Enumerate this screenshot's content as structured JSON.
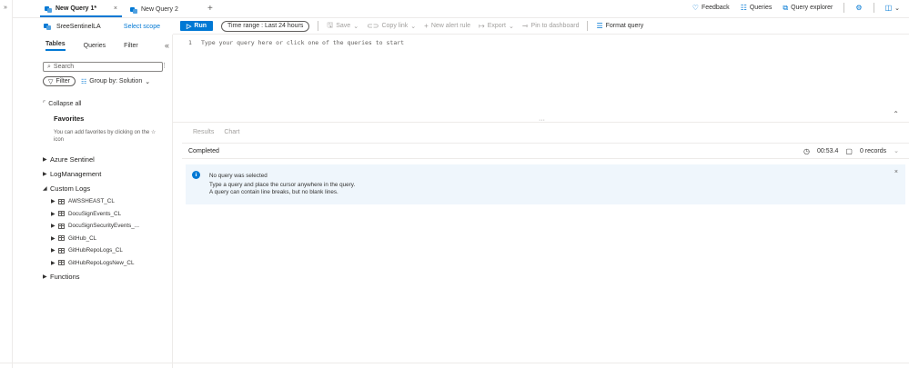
{
  "tabs": [
    {
      "label": "New Query 1*",
      "active": true,
      "close": "×"
    },
    {
      "label": "New Query 2",
      "active": false
    }
  ],
  "add_tab": "+",
  "rail_expand": "»",
  "top_links": {
    "feedback": "Feedback",
    "queries": "Queries",
    "query_explorer": "Query explorer"
  },
  "scope": {
    "workspace": "SreeSentinelLA",
    "select_scope": "Select scope"
  },
  "toolbar": {
    "run": "Run",
    "time_range": "Time range : Last 24 hours",
    "save": "Save",
    "copy_link": "Copy link",
    "new_alert_rule": "New alert rule",
    "export": "Export",
    "pin_to_dashboard": "Pin to dashboard",
    "format_query": "Format query"
  },
  "left_panel": {
    "tabs": [
      "Tables",
      "Queries",
      "Filter"
    ],
    "collapse": "«",
    "search_placeholder": "Search",
    "filter": "Filter",
    "group_by": "Group by: Solution",
    "collapse_all": "Collapse all",
    "favorites_title": "Favorites",
    "favorites_hint": "You can add favorites by clicking on the ☆ icon",
    "tree": {
      "azure_sentinel": "Azure Sentinel",
      "log_management": "LogManagement",
      "custom_logs": "Custom Logs",
      "custom_tables": [
        "AWSSHEAST_CL",
        "DocuSignEvents_CL",
        "DocuSignSecurityEvents_...",
        "GitHub_CL",
        "GitHubRepoLogs_CL",
        "GitHubRepoLogsNew_CL"
      ],
      "functions": "Functions"
    }
  },
  "editor": {
    "line_number": "1",
    "placeholder": "Type your query here or click one of the queries to start"
  },
  "results": {
    "tabs": [
      "Results",
      "Chart"
    ],
    "status": "Completed",
    "duration": "00:53.4",
    "records": "0 records",
    "message": {
      "line1": "No query was selected",
      "line2": "Type a query and place the cursor anywhere in the query.",
      "line3": "A query can contain line breaks, but no blank lines."
    }
  },
  "colors": {
    "accent": "#0078d4",
    "info_background": "#eff6fc"
  }
}
